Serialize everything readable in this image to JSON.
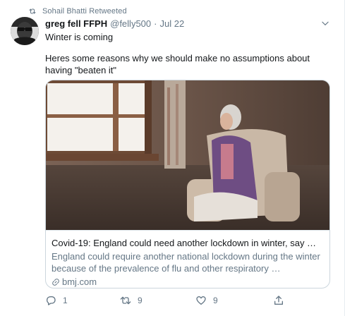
{
  "social_context": {
    "text": "Sohail Bhatti Retweeted",
    "icon": "retweet-icon"
  },
  "tweet": {
    "display_name": "greg fell FFPH",
    "handle": "@felly500",
    "separator": "·",
    "time": "Jul 22",
    "text_line1": "Winter is coming",
    "text_paragraph2": "Heres some reasons why we should make no assumptions about having \"beaten it\""
  },
  "card": {
    "title": "Covid-19: England could need another lockdown in winter, say …",
    "description": "England could require another national lockdown during the winter because of the prevalence of flu and other respiratory …",
    "domain": "bmj.com"
  },
  "actions": {
    "reply_count": "1",
    "retweet_count": "9",
    "like_count": "9"
  },
  "colors": {
    "secondary_text": "#657786",
    "primary_text": "#14171a",
    "border": "#ccd6dd"
  }
}
